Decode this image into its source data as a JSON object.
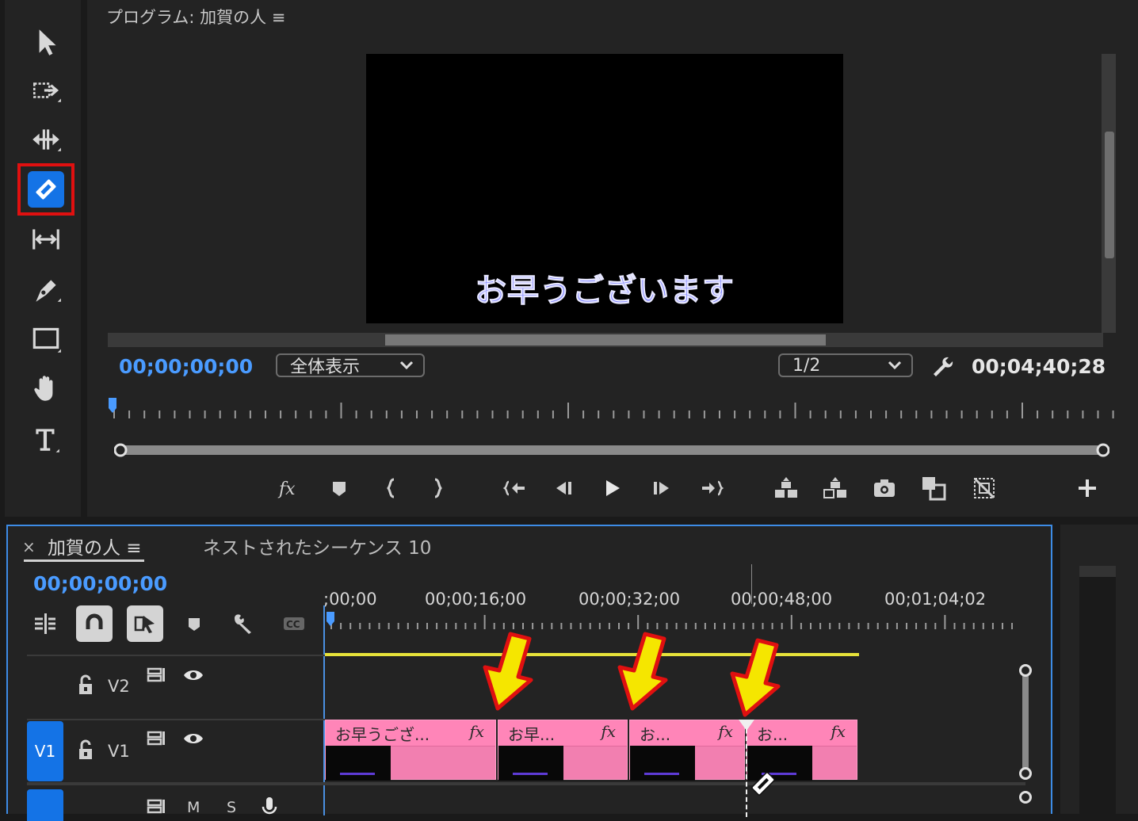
{
  "tools": {
    "items": [
      {
        "name": "selection-tool"
      },
      {
        "name": "track-select-forward-tool"
      },
      {
        "name": "ripple-edit-tool"
      },
      {
        "name": "razor-tool",
        "active": true,
        "highlight_color": "#e01010"
      },
      {
        "name": "slip-tool"
      },
      {
        "name": "pen-tool"
      },
      {
        "name": "rectangle-tool"
      },
      {
        "name": "hand-tool"
      },
      {
        "name": "type-tool"
      }
    ]
  },
  "monitor": {
    "title": "プログラム: 加賀の人 ≡",
    "subtitle_text": "お早うございます",
    "timecode": "00;00;00;00",
    "zoom_select": "全体表示",
    "resolution_select": "1/2",
    "duration": "00;04;40;28",
    "controls": [
      "fx-icon",
      "marker-icon",
      "mark-in-icon",
      "mark-out-icon",
      "go-to-in-icon",
      "step-back-icon",
      "play-icon",
      "step-forward-icon",
      "go-to-out-icon",
      "lift-icon",
      "extract-icon",
      "export-frame-icon",
      "compare-icon",
      "safe-margins-icon",
      "add-button-icon"
    ]
  },
  "timeline": {
    "tab_close": "×",
    "active_tab": "加賀の人 ≡",
    "other_tab": "ネストされたシーケンス 10",
    "timecode": "00;00;00;00",
    "ruler_labels": [
      ";00;00",
      "00;00;16;00",
      "00;00;32;00",
      "00;00;48;00",
      "00;01;04;02"
    ],
    "tracks": {
      "v2": "V2",
      "v1": "V1",
      "v1_target": "V1",
      "a1_mute": "M",
      "a1_solo": "S"
    },
    "clips": [
      {
        "name": "お早うござ...",
        "fx": "fx"
      },
      {
        "name": "お早...",
        "fx": "fx"
      },
      {
        "name": "お...",
        "fx": "fx"
      },
      {
        "name": "お...",
        "fx": "fx"
      }
    ],
    "clip_color": "#f27fb0",
    "work_area_color": "#e6e23a",
    "arrow_fill": "#f5e600",
    "arrow_stroke": "#e01010"
  }
}
